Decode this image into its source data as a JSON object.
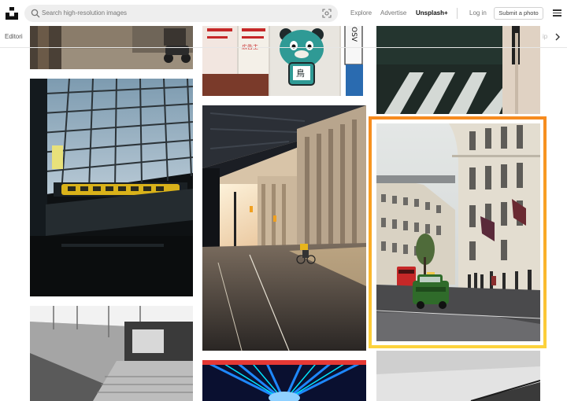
{
  "header": {
    "search_placeholder": "Search high-resolution images",
    "nav": {
      "explore": "Explore",
      "advertise": "Advertise",
      "unsplash_plus": "Unsplash+",
      "login": "Log in"
    },
    "submit_label": "Submit a photo"
  },
  "subnav": {
    "left_tab": "Editori",
    "right_tab_fragment": "ip"
  },
  "photos": {
    "poster_sign_text": "広告主",
    "bear_sign_text": "鳥",
    "vertical_sign_text": "OSV"
  },
  "colors": {
    "highlight": "#f7b32b",
    "taxi": "#2f6b2a",
    "bus": "#c62828",
    "train": "#e6b800"
  }
}
